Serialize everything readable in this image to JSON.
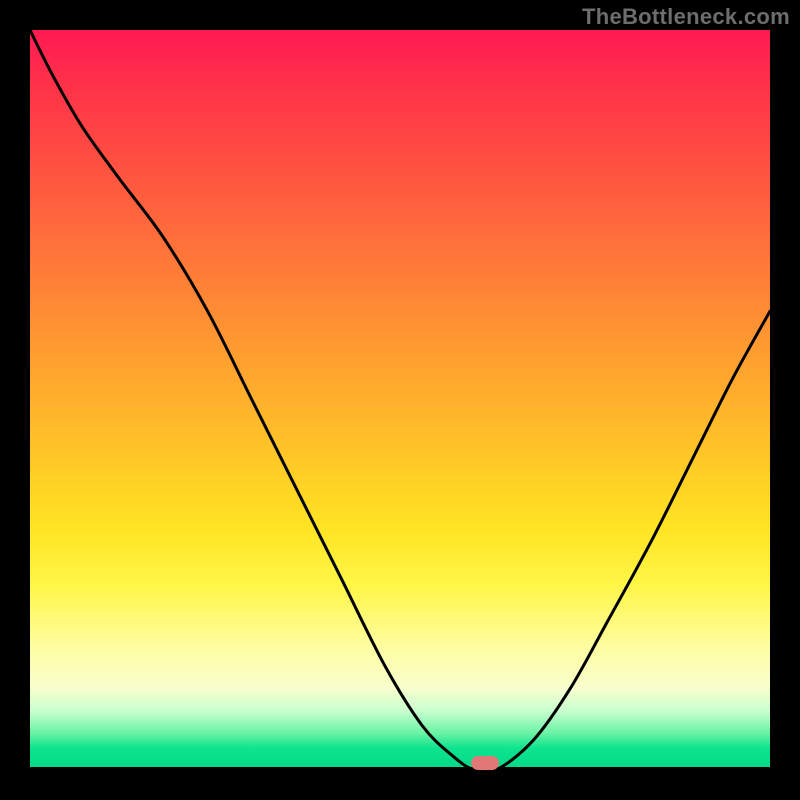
{
  "watermark": "TheBottleneck.com",
  "chart_data": {
    "type": "line",
    "title": "",
    "xlabel": "",
    "ylabel": "",
    "xlim": [
      0,
      100
    ],
    "ylim": [
      0,
      100
    ],
    "grid": false,
    "legend": false,
    "series": [
      {
        "name": "curve",
        "x": [
          0,
          3,
          7,
          12,
          18,
          24,
          30,
          36,
          42,
          48,
          53,
          57,
          60,
          63,
          68,
          73,
          78,
          84,
          90,
          95,
          100
        ],
        "y": [
          100,
          94,
          87,
          80,
          72,
          62,
          50,
          38,
          26,
          14,
          6,
          2,
          0,
          0,
          4,
          11,
          20,
          31,
          43,
          53,
          62
        ]
      }
    ],
    "marker": {
      "x": 61.5,
      "y": 0.5
    },
    "colors": {
      "curve": "#000000",
      "marker": "#e07878",
      "gradient_top": "#ff1a52",
      "gradient_mid": "#ffe322",
      "gradient_bottom": "#00d988",
      "frame": "#000000"
    }
  }
}
